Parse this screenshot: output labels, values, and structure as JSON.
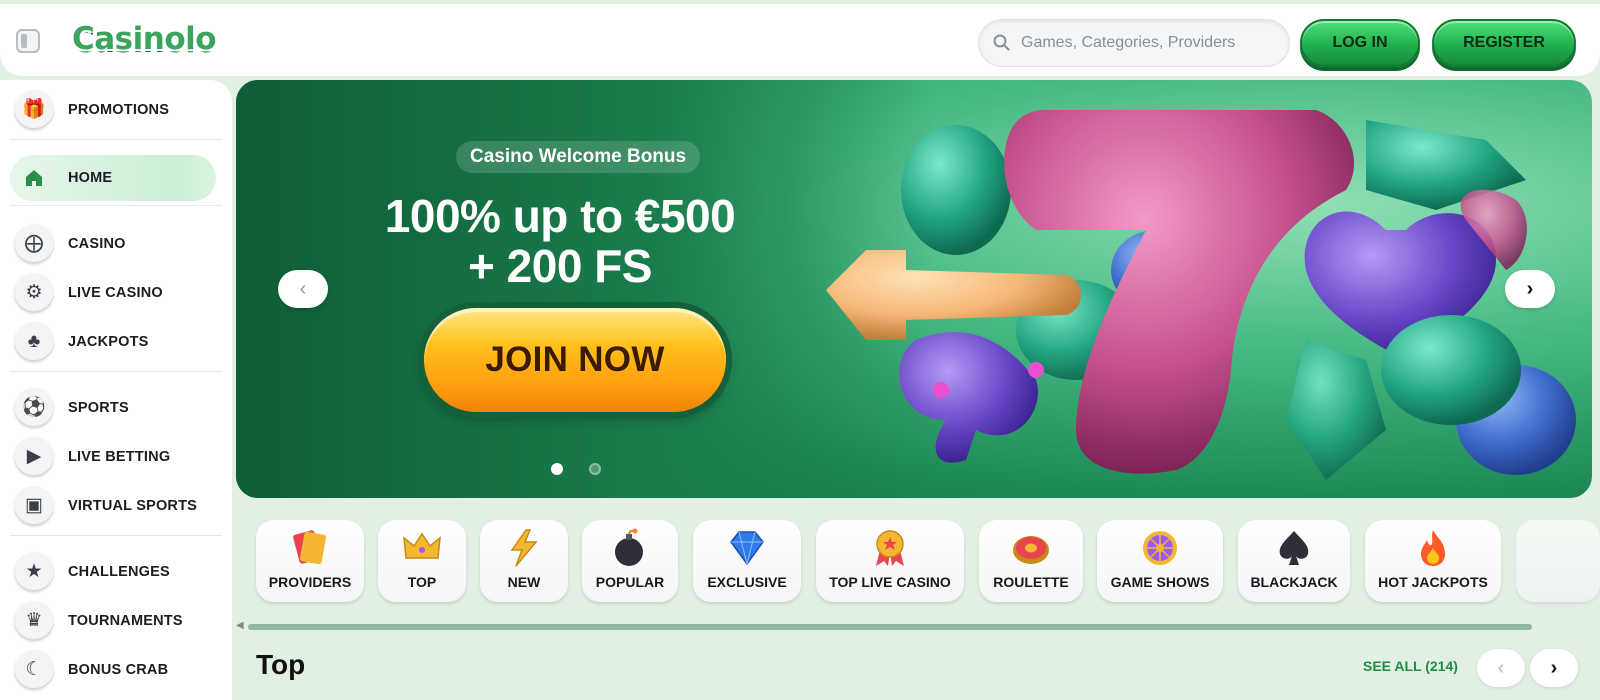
{
  "header": {
    "logo_text": "Casinolo",
    "search_placeholder": "Games, Categories, Providers",
    "login_label": "LOG IN",
    "register_label": "REGISTER"
  },
  "sidebar": {
    "items": [
      {
        "label": "PROMOTIONS",
        "icon": "gift-icon"
      },
      {
        "label": "HOME",
        "icon": "home-icon",
        "active": true
      },
      {
        "label": "CASINO",
        "icon": "casino-chip-icon"
      },
      {
        "label": "LIVE CASINO",
        "icon": "poker-chip-icon"
      },
      {
        "label": "JACKPOTS",
        "icon": "club-icon"
      },
      {
        "label": "SPORTS",
        "icon": "soccer-ball-icon"
      },
      {
        "label": "LIVE BETTING",
        "icon": "tv-play-icon"
      },
      {
        "label": "VIRTUAL SPORTS",
        "icon": "virtual-sports-icon"
      },
      {
        "label": "CHALLENGES",
        "icon": "star-trophy-icon"
      },
      {
        "label": "TOURNAMENTS",
        "icon": "trophy-icon"
      },
      {
        "label": "BONUS CRAB",
        "icon": "crab-icon"
      }
    ]
  },
  "banner": {
    "tag": "Casino Welcome Bonus",
    "headline_line1": "100% up to €500",
    "headline_line2": "+ 200 FS",
    "cta_label": "JOIN NOW",
    "slide_count": 2,
    "active_slide": 1,
    "prev_icon": "chevron-left-icon",
    "next_icon": "chevron-right-icon"
  },
  "categories": [
    {
      "label": "PROVIDERS",
      "icon": "cards-icon"
    },
    {
      "label": "TOP",
      "icon": "crown-icon"
    },
    {
      "label": "NEW",
      "icon": "lightning-icon"
    },
    {
      "label": "POPULAR",
      "icon": "bomb-icon"
    },
    {
      "label": "EXCLUSIVE",
      "icon": "diamond-icon"
    },
    {
      "label": "TOP LIVE CASINO",
      "icon": "medal-icon"
    },
    {
      "label": "ROULETTE",
      "icon": "roulette-icon"
    },
    {
      "label": "GAME SHOWS",
      "icon": "wheel-icon"
    },
    {
      "label": "BLACKJACK",
      "icon": "spade-icon"
    },
    {
      "label": "HOT JACKPOTS",
      "icon": "flame-icon"
    }
  ],
  "section": {
    "title": "Top",
    "see_all_label": "SEE ALL (214)"
  },
  "colors": {
    "accent_green": "#22b04d",
    "page_bg": "#e2efe3",
    "cta_orange": "#ffb21a"
  }
}
